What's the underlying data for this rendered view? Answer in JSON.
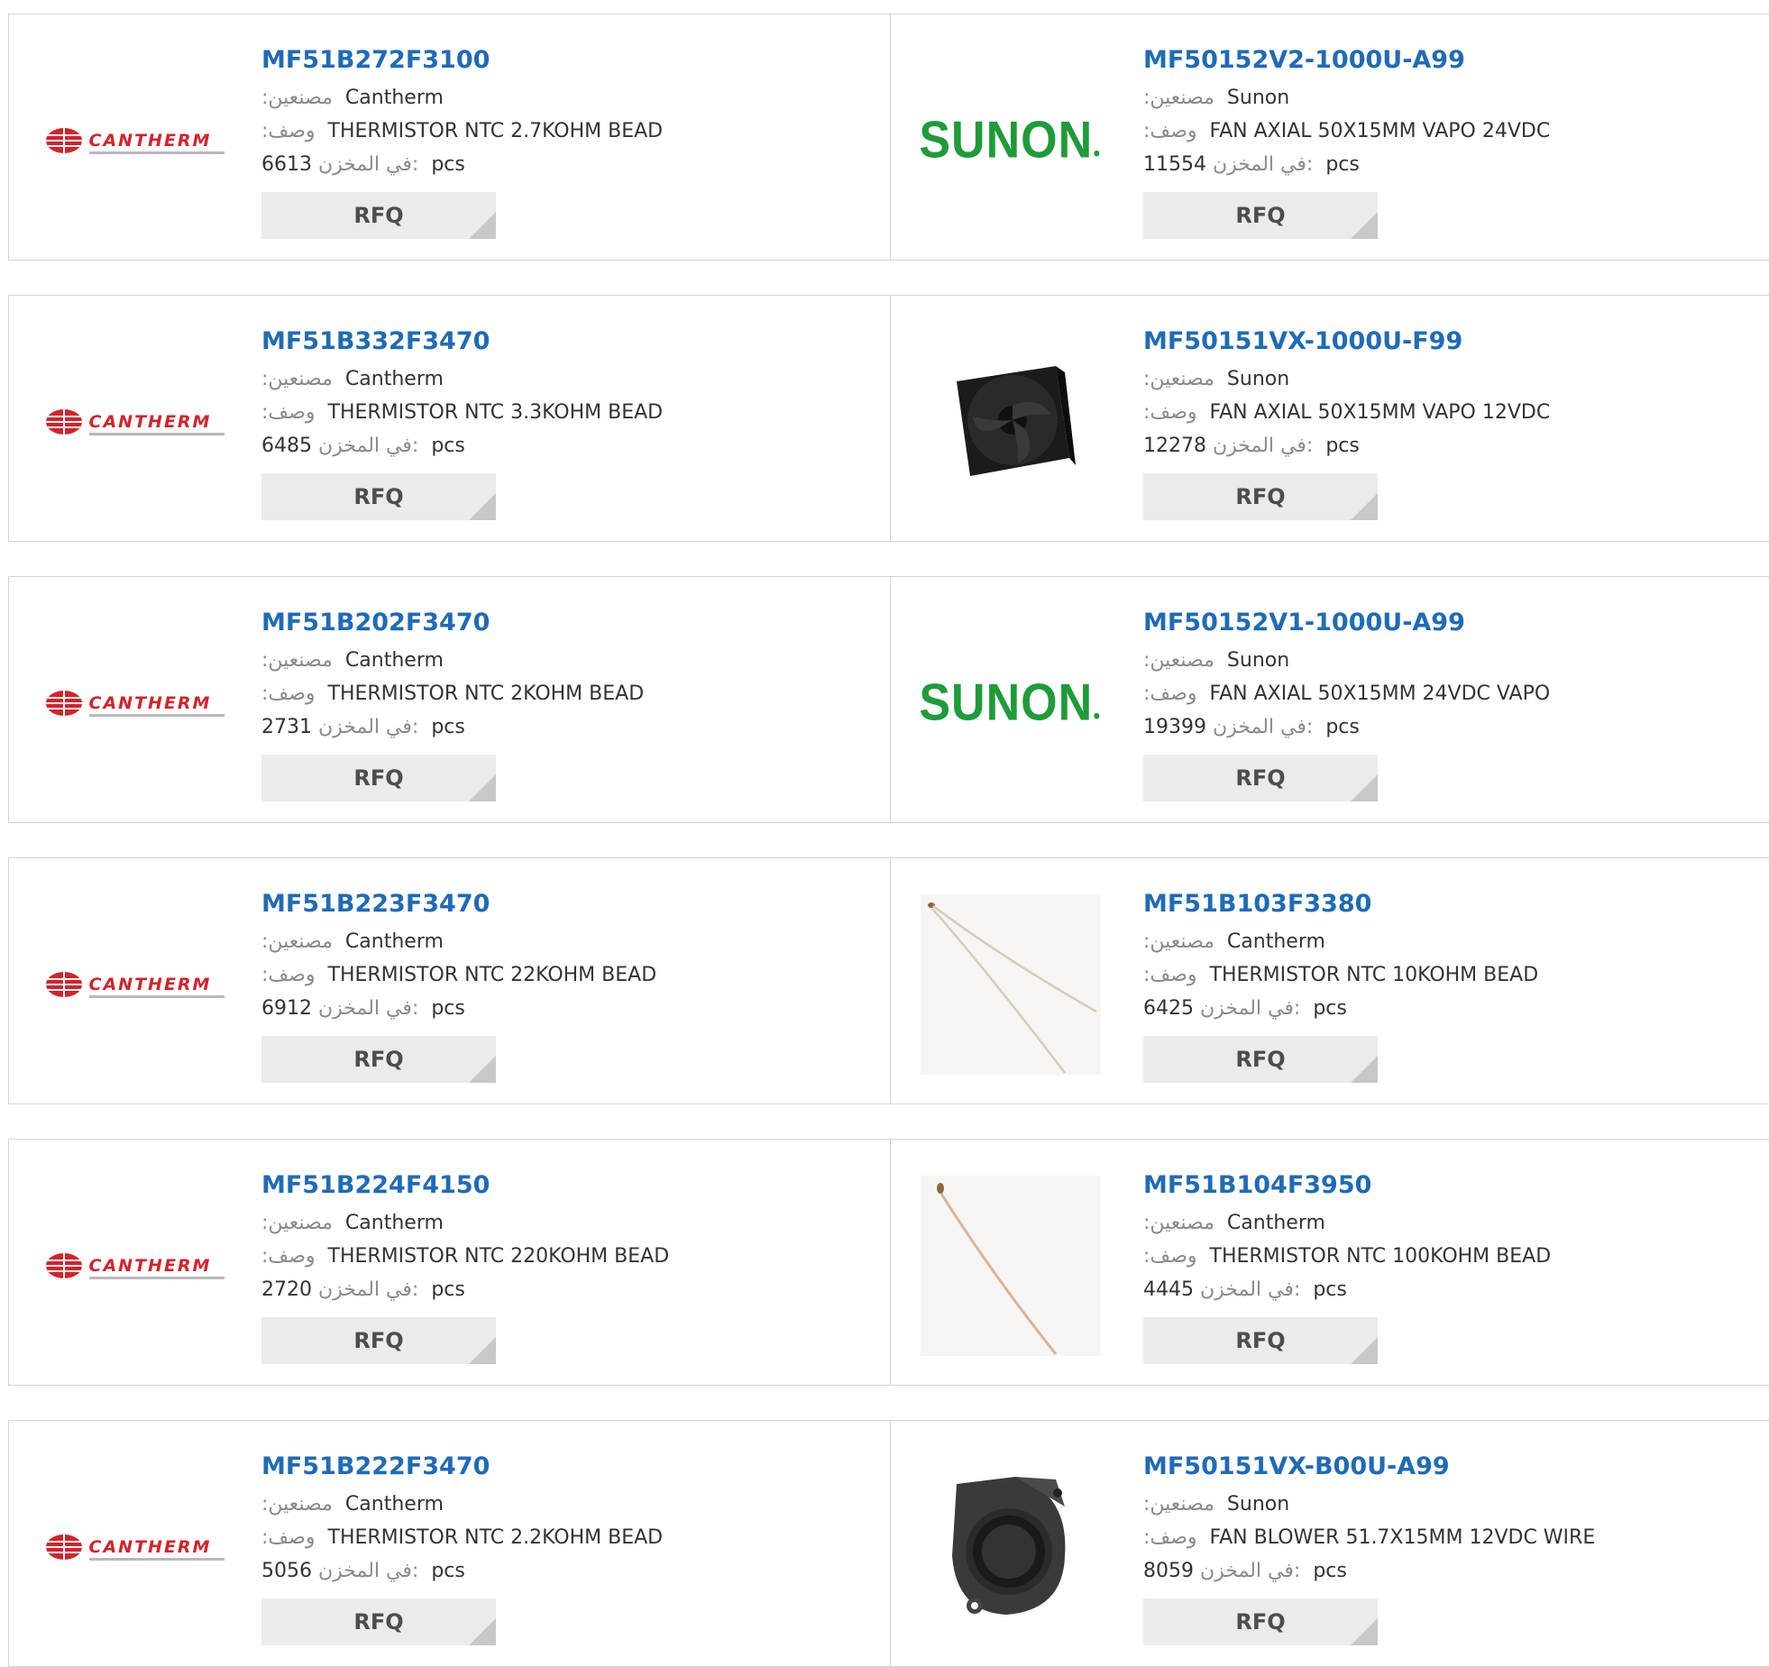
{
  "labels": {
    "manufacturer": ":مصنعين",
    "description": ":وصف",
    "stock": "في المخزن:",
    "unit": "pcs",
    "rfq": "RFQ"
  },
  "products": [
    {
      "part": "MF51B272F3100",
      "manufacturer": "Cantherm",
      "description": "THERMISTOR NTC 2.7KOHM BEAD",
      "stock": "6613",
      "logo": "cantherm-logo"
    },
    {
      "part": "MF50152V2-1000U-A99",
      "manufacturer": "Sunon",
      "description": "FAN AXIAL 50X15MM VAPO 24VDC",
      "stock": "11554",
      "logo": "sunon-logo",
      "logo_text": "SUNON"
    },
    {
      "part": "MF51B332F3470",
      "manufacturer": "Cantherm",
      "description": "THERMISTOR NTC 3.3KOHM BEAD",
      "stock": "6485",
      "logo": "cantherm-logo"
    },
    {
      "part": "MF50151VX-1000U-F99",
      "manufacturer": "Sunon",
      "description": "FAN AXIAL 50X15MM VAPO 12VDC",
      "stock": "12278",
      "logo": "axial-fan-photo"
    },
    {
      "part": "MF51B202F3470",
      "manufacturer": "Cantherm",
      "description": "THERMISTOR NTC 2KOHM BEAD",
      "stock": "2731",
      "logo": "cantherm-logo"
    },
    {
      "part": "MF50152V1-1000U-A99",
      "manufacturer": "Sunon",
      "description": "FAN AXIAL 50X15MM 24VDC VAPO",
      "stock": "19399",
      "logo": "sunon-logo",
      "logo_text": "SUNON"
    },
    {
      "part": "MF51B223F3470",
      "manufacturer": "Cantherm",
      "description": "THERMISTOR NTC 22KOHM BEAD",
      "stock": "6912",
      "logo": "cantherm-logo"
    },
    {
      "part": "MF51B103F3380",
      "manufacturer": "Cantherm",
      "description": "THERMISTOR NTC 10KOHM BEAD",
      "stock": "6425",
      "logo": "thermistor-wire-photo"
    },
    {
      "part": "MF51B224F4150",
      "manufacturer": "Cantherm",
      "description": "THERMISTOR NTC 220KOHM BEAD",
      "stock": "2720",
      "logo": "cantherm-logo"
    },
    {
      "part": "MF51B104F3950",
      "manufacturer": "Cantherm",
      "description": "THERMISTOR NTC 100KOHM BEAD",
      "stock": "4445",
      "logo": "thermistor-single-wire-photo"
    },
    {
      "part": "MF51B222F3470",
      "manufacturer": "Cantherm",
      "description": "THERMISTOR NTC 2.2KOHM BEAD",
      "stock": "5056",
      "logo": "cantherm-logo"
    },
    {
      "part": "MF50151VX-B00U-A99",
      "manufacturer": "Sunon",
      "description": "FAN BLOWER 51.7X15MM 12VDC WIRE",
      "stock": "8059",
      "logo": "blower-fan-photo"
    }
  ]
}
